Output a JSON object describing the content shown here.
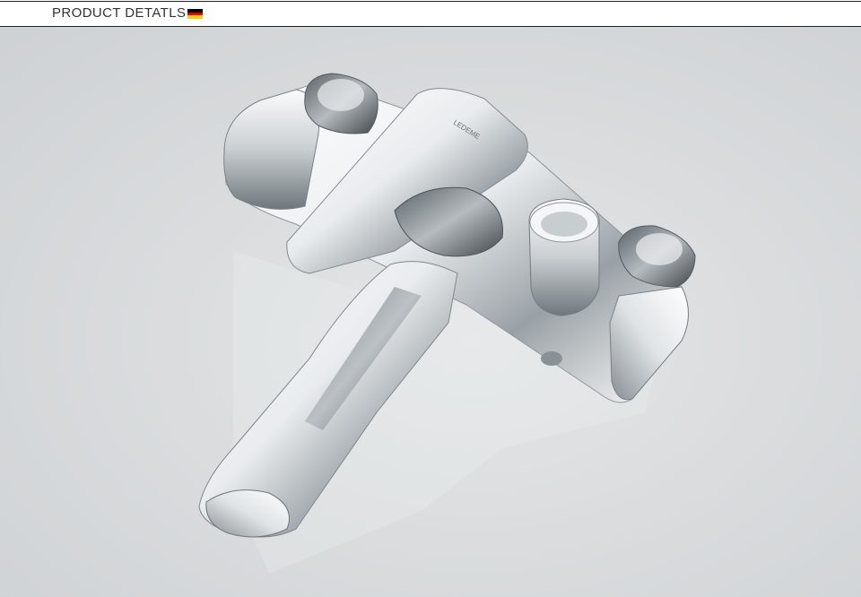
{
  "header": {
    "title": "PRODUCT DETATLS",
    "flag_icon": "germany-flag-icon",
    "flag_colors": [
      "#000000",
      "#dd0000",
      "#ffce00"
    ]
  },
  "photo": {
    "subject": "chrome-bath-shower-mixer-faucet",
    "brand_mark": "LEDEME",
    "background_color": "#d9dbdc",
    "accent_color": "#f5f6f7"
  }
}
